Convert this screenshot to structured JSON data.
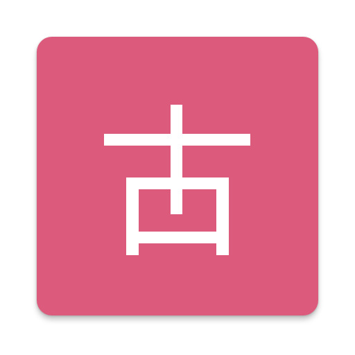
{
  "app_icon": {
    "glyph": "古",
    "background_color": "#dc5a7c",
    "glyph_color": "#ffffff"
  }
}
